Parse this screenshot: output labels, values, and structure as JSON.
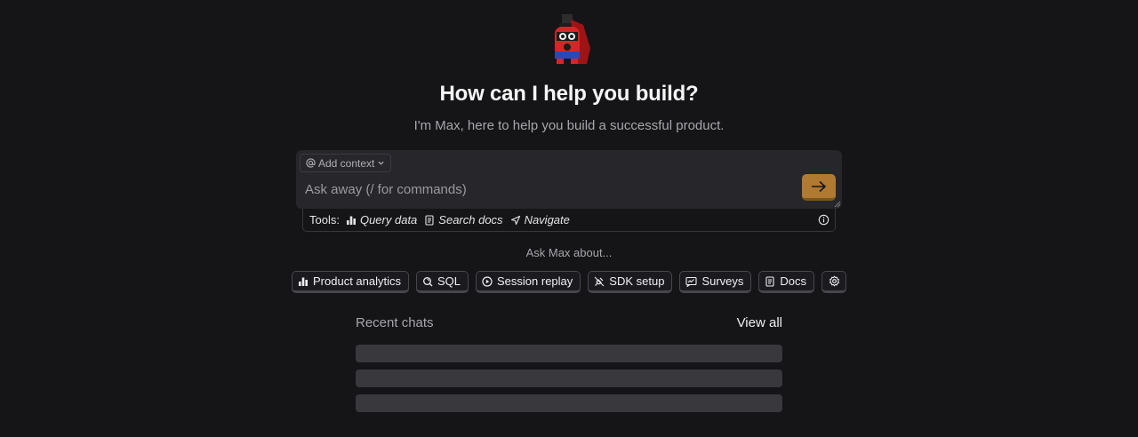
{
  "hero": {
    "title": "How can I help you build?",
    "subtitle": "I'm Max, here to help you build a successful product."
  },
  "composer": {
    "add_context_label": "Add context",
    "placeholder": "Ask away (/ for commands)",
    "value": "",
    "send_icon": "arrow-right-icon"
  },
  "tools": {
    "label": "Tools:",
    "items": [
      {
        "label": "Query data",
        "icon": "bar-chart-icon"
      },
      {
        "label": "Search docs",
        "icon": "doc-icon"
      },
      {
        "label": "Navigate",
        "icon": "compass-icon"
      }
    ]
  },
  "suggestions": {
    "heading": "Ask Max about...",
    "chips": [
      {
        "label": "Product analytics",
        "icon": "bar-chart-icon"
      },
      {
        "label": "SQL",
        "icon": "database-search-icon"
      },
      {
        "label": "Session replay",
        "icon": "play-circle-icon"
      },
      {
        "label": "SDK setup",
        "icon": "plug-icon"
      },
      {
        "label": "Surveys",
        "icon": "survey-icon"
      },
      {
        "label": "Docs",
        "icon": "book-icon"
      }
    ],
    "settings_icon": "gear-icon"
  },
  "recent": {
    "title": "Recent chats",
    "view_all_label": "View all",
    "loading_rows": 3
  },
  "colors": {
    "background": "#151518",
    "accent": "#b07a33",
    "composer_bg": "#26262b",
    "skeleton": "#38383d"
  }
}
